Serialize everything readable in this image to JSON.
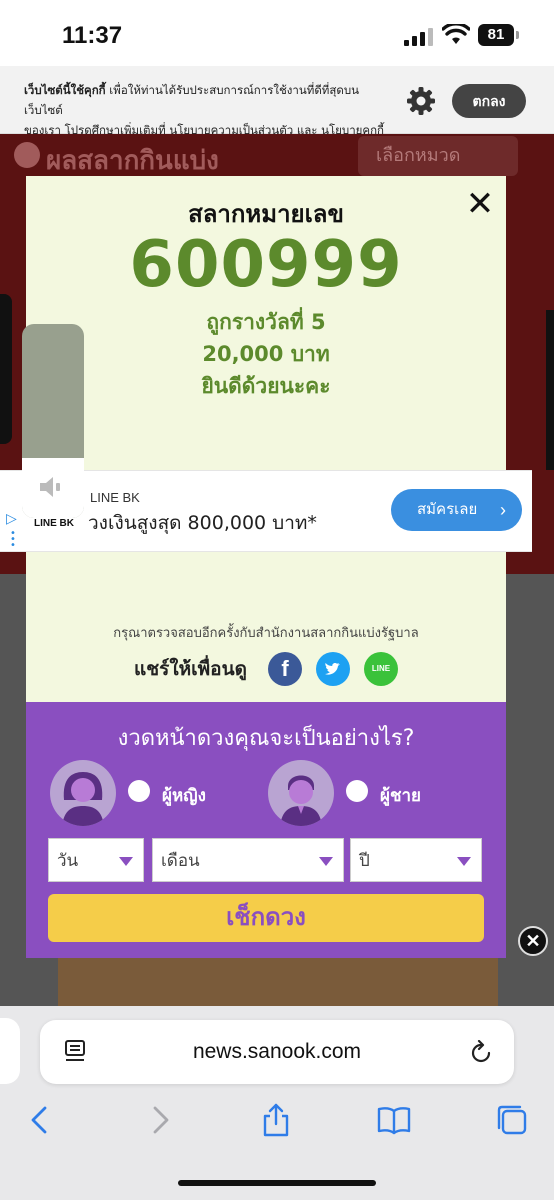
{
  "status_bar": {
    "time": "11:37",
    "battery": "81"
  },
  "cookie": {
    "bold_lead": "เว็บไซต์นี้ใช้คุกกี้",
    "text_part1": " เพื่อให้ท่านได้รับประสบการณ์การใช้งานที่ดีที่สุดบน เว็บไซต์",
    "text_part2": "ของเรา โปรดศึกษาเพิ่มเติมที่ ",
    "privacy_link": "นโยบายความเป็นส่วนตัว",
    "and": " และ ",
    "cookie_link": "นโยบายคุกกี้",
    "accept_label": "ตกลง"
  },
  "background_page": {
    "title": "ผลสลากกินแบ่ง",
    "category_select": "เลือกหมวด"
  },
  "modal": {
    "title": "สลากหมายเลข",
    "number": "600999",
    "prize_rank": "ถูกรางวัลที่ 5",
    "prize_amount": "20,000 บาท",
    "congrats": "ยินดีด้วยนะคะ",
    "recheck_note": "กรุณาตรวจสอบอีกครั้งกับสำนักงานสลากกินแบ่งรัฐบาล",
    "share_label": "แชร์ให้เพื่อนดู",
    "share_line_label": "LINE"
  },
  "fortune": {
    "title": "งวดหน้าดวงคุณจะเป็นอย่างไร?",
    "female_label": "ผู้หญิง",
    "male_label": "ผู้ชาย",
    "day_placeholder": "วัน",
    "month_placeholder": "เดือน",
    "year_placeholder": "ปี",
    "check_button": "เช็กดวง"
  },
  "ad": {
    "brand": "LINE BK",
    "brand_small": "LINE BK",
    "text": "วงเงินสูงสุด 800,000 บาท*",
    "cta": "สมัครเลย"
  },
  "browser": {
    "url": "news.sanook.com"
  },
  "colors": {
    "modal_bg": "#f3f8df",
    "accent_green": "#5c8a2c",
    "fortune_purple": "#8a4fc0",
    "check_yellow": "#f5cd49",
    "ad_blue": "#3a8fe0"
  }
}
